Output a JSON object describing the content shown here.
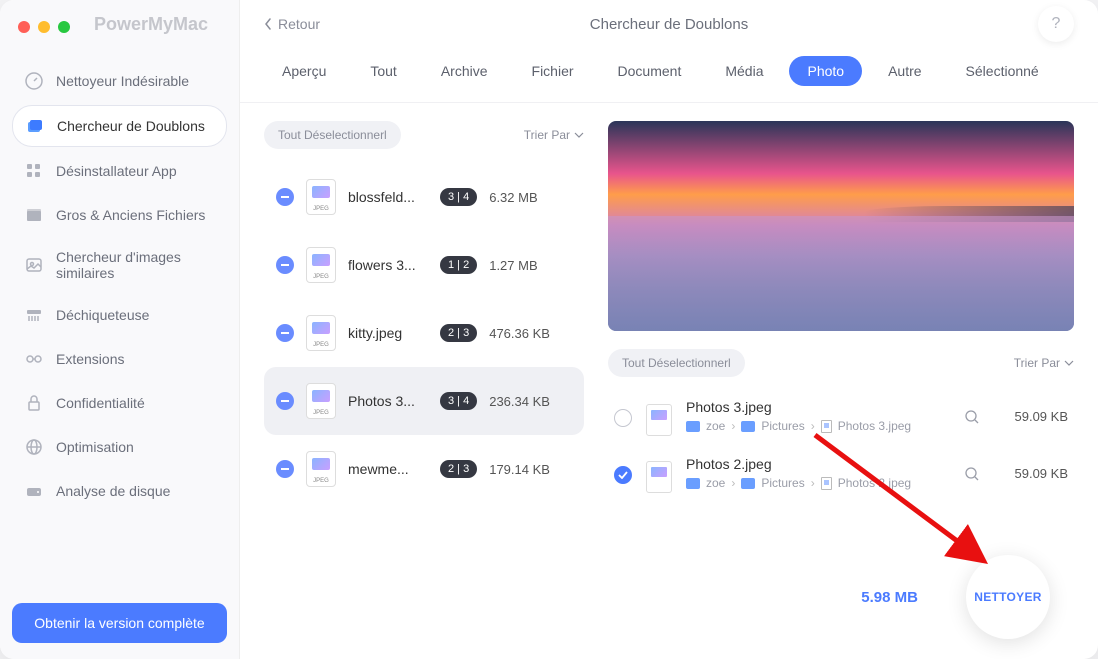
{
  "brand": "PowerMyMac",
  "back_label": "Retour",
  "title": "Chercheur de Doublons",
  "help_label": "?",
  "sidebar": {
    "items": [
      {
        "label": "Nettoyeur Indésirable",
        "icon": "gauge"
      },
      {
        "label": "Chercheur de Doublons",
        "icon": "layers",
        "active": true
      },
      {
        "label": "Désinstallateur App",
        "icon": "grid"
      },
      {
        "label": "Gros & Anciens Fichiers",
        "icon": "box"
      },
      {
        "label": "Chercheur d'images similaires",
        "icon": "image"
      },
      {
        "label": "Déchiqueteuse",
        "icon": "shred"
      },
      {
        "label": "Extensions",
        "icon": "ext"
      },
      {
        "label": "Confidentialité",
        "icon": "lock"
      },
      {
        "label": "Optimisation",
        "icon": "globe"
      },
      {
        "label": "Analyse de disque",
        "icon": "disk"
      }
    ],
    "cta": "Obtenir la version complète"
  },
  "tabs": [
    "Aperçu",
    "Tout",
    "Archive",
    "Fichier",
    "Document",
    "Média",
    "Photo",
    "Autre",
    "Sélectionné"
  ],
  "active_tab": "Photo",
  "deselect_label": "Tout Déselectionnerl",
  "sort_label": "Trier Par",
  "files": [
    {
      "name": "blossfeld...",
      "badge": "3 | 4",
      "size": "6.32 MB"
    },
    {
      "name": "flowers 3...",
      "badge": "1 | 2",
      "size": "1.27 MB"
    },
    {
      "name": "kitty.jpeg",
      "badge": "2 | 3",
      "size": "476.36 KB"
    },
    {
      "name": "Photos 3...",
      "badge": "3 | 4",
      "size": "236.34 KB",
      "selected": true
    },
    {
      "name": "mewme...",
      "badge": "2 | 3",
      "size": "179.14 KB"
    }
  ],
  "thumb_label": "JPEG",
  "details": [
    {
      "name": "Photos 3.jpeg",
      "path": [
        "zoe",
        "Pictures",
        "Photos 3.jpeg"
      ],
      "size": "59.09 KB",
      "checked": false
    },
    {
      "name": "Photos 2.jpeg",
      "path": [
        "zoe",
        "Pictures",
        "Photos 2.jpeg"
      ],
      "size": "59.09 KB",
      "checked": true
    }
  ],
  "total_size": "5.98 MB",
  "clean_label": "NETTOYER"
}
